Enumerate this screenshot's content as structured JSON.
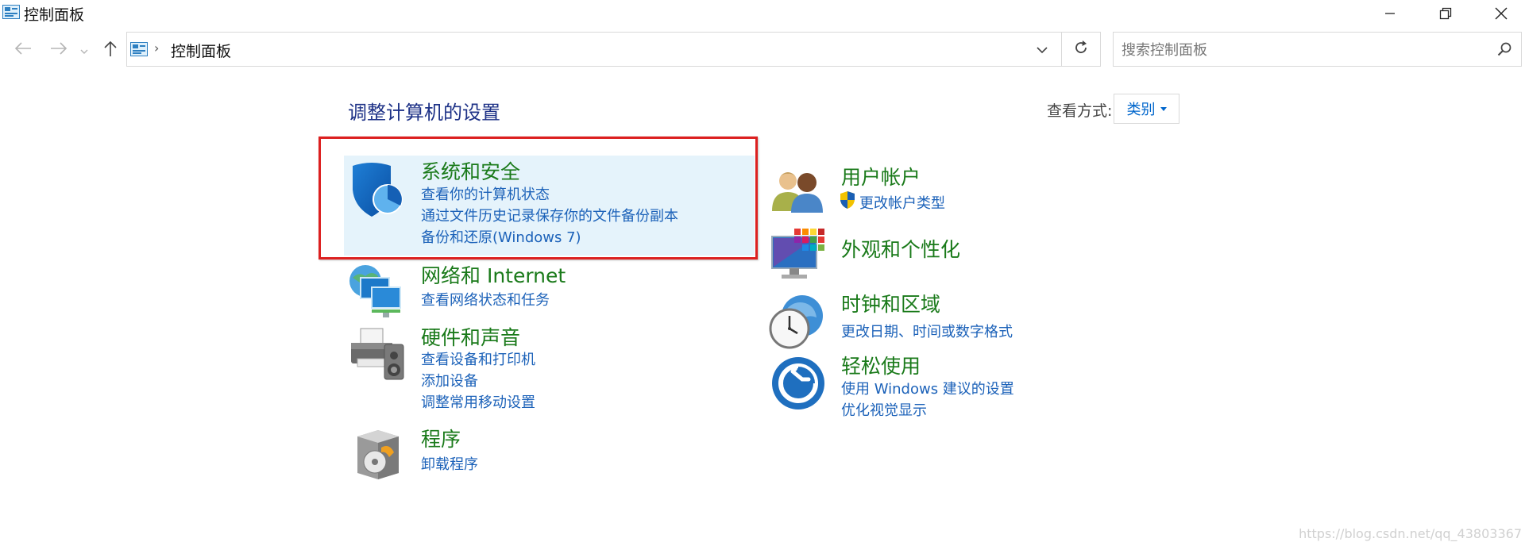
{
  "window": {
    "title": "控制面板",
    "icon": "control-panel-icon",
    "controls": [
      "minimize-icon",
      "restore-icon",
      "close-icon"
    ]
  },
  "nav": {
    "back_icon": "arrow-left-icon",
    "forward_icon": "arrow-right-icon",
    "recent_icon": "chevron-down-icon",
    "up_icon": "arrow-up-icon"
  },
  "address": {
    "breadcrumb": "控制面板",
    "separator": "›",
    "dropdown_icon": "chevron-down-icon",
    "refresh_icon": "refresh-icon"
  },
  "search": {
    "placeholder": "搜索控制面板",
    "value": "",
    "icon": "search-icon"
  },
  "content": {
    "heading": "调整计算机的设置",
    "view_by_label": "查看方式:",
    "view_by_value": "类别"
  },
  "categories": {
    "system_security": {
      "title": "系统和安全",
      "icon": "shield-icon",
      "links": [
        "查看你的计算机状态",
        "通过文件历史记录保存你的文件备份副本",
        "备份和还原(Windows 7)"
      ]
    },
    "network": {
      "title": "网络和 Internet",
      "icon": "network-globe-icon",
      "links": [
        "查看网络状态和任务"
      ]
    },
    "hardware": {
      "title": "硬件和声音",
      "icon": "printer-speaker-icon",
      "links": [
        "查看设备和打印机",
        "添加设备",
        "调整常用移动设置"
      ]
    },
    "programs": {
      "title": "程序",
      "icon": "programs-disc-icon",
      "links": [
        "卸载程序"
      ]
    },
    "user_accounts": {
      "title": "用户帐户",
      "icon": "users-icon",
      "links": [
        "更改帐户类型"
      ],
      "link_icon": "uac-shield-icon"
    },
    "appearance": {
      "title": "外观和个性化",
      "icon": "monitor-color-icon",
      "links": []
    },
    "clock": {
      "title": "时钟和区域",
      "icon": "clock-globe-icon",
      "links": [
        "更改日期、时间或数字格式"
      ]
    },
    "ease_of_access": {
      "title": "轻松使用",
      "icon": "ease-of-access-icon",
      "links": [
        "使用 Windows 建议的设置",
        "优化视觉显示"
      ]
    }
  },
  "colors": {
    "category_title": "#1a7a1a",
    "link": "#1c62b9",
    "heading": "#1e3287",
    "highlight": "#e5f3fb",
    "annotation_box": "#dc2020"
  },
  "watermark": "https://blog.csdn.net/qq_43803367"
}
